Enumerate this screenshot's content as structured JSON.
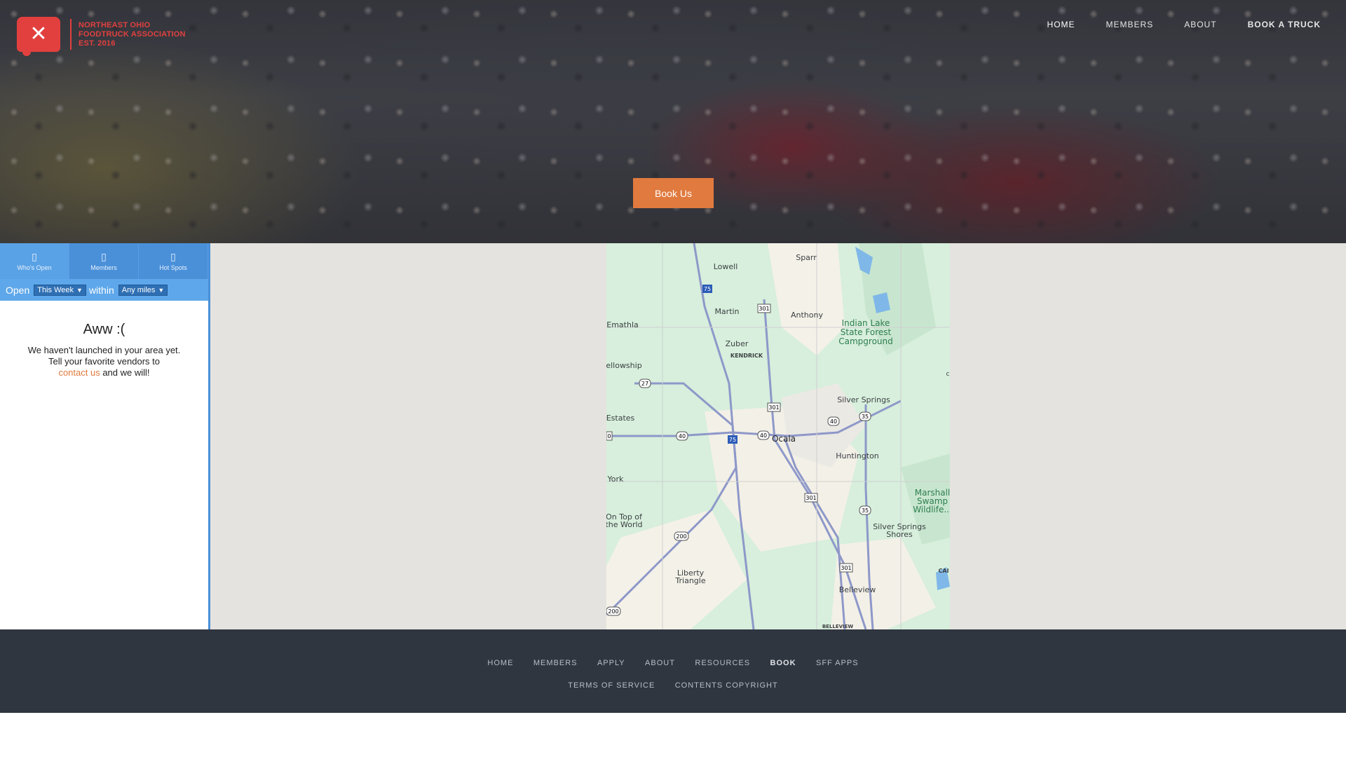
{
  "brand": {
    "line1": "NORTHEAST OHIO",
    "line2": "FOODTRUCK ASSOCIATION",
    "line3": "EST. 2016",
    "color": "#e2403f"
  },
  "top_nav": [
    "HOME",
    "MEMBERS",
    "ABOUT",
    "BOOK A TRUCK"
  ],
  "hero": {
    "cta_label": "Book Us",
    "cta_color": "#e07a3e"
  },
  "tabs": [
    {
      "icon": "utensils-icon",
      "label": "Who's Open"
    },
    {
      "icon": "truck-icon",
      "label": "Members"
    },
    {
      "icon": "map-pin-icon",
      "label": "Hot Spots"
    }
  ],
  "filters": {
    "open_label": "Open",
    "period_value": "This Week",
    "within_label": "within",
    "distance_value": "Any miles"
  },
  "empty_state": {
    "title": "Aww :(",
    "line1": "We haven't launched in your area yet.",
    "line2": "Tell your favorite vendors to",
    "link": "contact us",
    "line3": " and we will!"
  },
  "map_labels": {
    "lowell": "Lowell",
    "sparr": "Sparr",
    "martin": "Martin",
    "anthony": "Anthony",
    "emathla": "Emathla",
    "indian1": "Indian Lake",
    "indian2": "State Forest",
    "indian3": "Campground",
    "zuber": "Zuber",
    "kendrick": "KENDRICK",
    "fellowship": "ellowship",
    "silver_springs": "Silver Springs",
    "estates": "Estates",
    "ocala": "Ocala",
    "huntington": "Huntington",
    "york": "York",
    "marshall1": "Marshall",
    "marshall2": "Swamp",
    "marshall3": "Wildlife...",
    "ontop1": "On Top of",
    "ontop2": "the World",
    "ssshores1": "Silver Springs",
    "ssshores2": "Shores",
    "liberty1": "Liberty",
    "liberty2": "Triangle",
    "belleview": "Belleview",
    "belleview_caps": "BELLEVIEW",
    "c_edge": "c",
    "cal": "CAI",
    "r75a": "75",
    "r75b": "75",
    "r301a": "301",
    "r301b": "301",
    "r301c": "301",
    "r301d": "301",
    "r27": "27",
    "r40a": "40",
    "r40b": "40",
    "r40c": "40",
    "r35a": "35",
    "r35b": "35",
    "r200a": "200",
    "r200b": "200",
    "r0": "0"
  },
  "footer_nav": [
    "HOME",
    "MEMBERS",
    "APPLY",
    "ABOUT",
    "RESOURCES",
    "BOOK",
    "SFF APPS"
  ],
  "footer_legal": [
    "TERMS OF SERVICE",
    "CONTENTS COPYRIGHT"
  ]
}
